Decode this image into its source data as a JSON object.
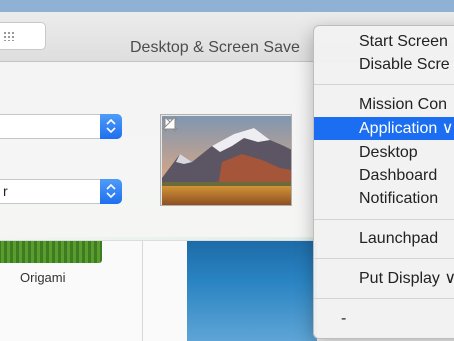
{
  "window": {
    "title": "Desktop & Screen Save"
  },
  "popups": {
    "second_value": "r"
  },
  "screensavers": {
    "items": [
      "Origami"
    ]
  },
  "hot_corner_menu": {
    "group1": [
      "Start Screen",
      "Disable Scre"
    ],
    "group2": [
      "Mission Con",
      "Application ∨",
      "Desktop",
      "Dashboard",
      "Notification"
    ],
    "group3": [
      "Launchpad"
    ],
    "group4": [
      "Put Display ∨"
    ],
    "group5": [
      "-"
    ],
    "selected": "Application ∨"
  },
  "colors": {
    "menu_highlight": "#1b6ef2",
    "stepper_blue": "#1e6ff0",
    "window_chrome": "#ececec"
  },
  "icons": {
    "grid": "grid-icon",
    "stepper": "chevron-up-down-icon",
    "corner": "hot-corner-triangle-icon"
  }
}
